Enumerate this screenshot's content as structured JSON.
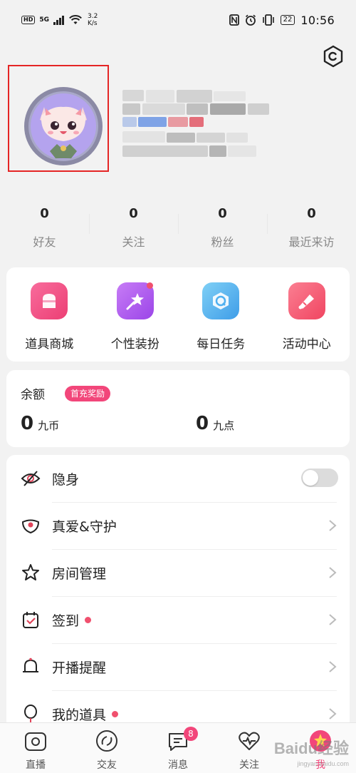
{
  "status_bar": {
    "hd": "HD",
    "signal": "5G",
    "speed_value": "3.2",
    "speed_unit": "K/s",
    "battery": "22",
    "time": "10:56"
  },
  "stats": [
    {
      "count": "0",
      "label": "好友"
    },
    {
      "count": "0",
      "label": "关注"
    },
    {
      "count": "0",
      "label": "粉丝"
    },
    {
      "count": "0",
      "label": "最近来访"
    }
  ],
  "quick_actions": [
    {
      "label": "道具商城",
      "color": "#f04d86",
      "icon": "shop-icon"
    },
    {
      "label": "个性装扮",
      "color": "#b45cf0",
      "icon": "magic-wand-icon",
      "dot": true
    },
    {
      "label": "每日任务",
      "color": "#4fb0f0",
      "icon": "task-badge-icon"
    },
    {
      "label": "活动中心",
      "color": "#f4566f",
      "icon": "megaphone-icon"
    }
  ],
  "balance": {
    "title": "余额",
    "badge": "首充奖励",
    "coins_value": "0",
    "coins_unit": "九币",
    "points_value": "0",
    "points_unit": "九点"
  },
  "menu": [
    {
      "label": "隐身",
      "icon": "eye-off-icon",
      "control": "toggle",
      "toggle_on": false
    },
    {
      "label": "真爱&守护",
      "icon": "mask-icon",
      "control": "chevron"
    },
    {
      "label": "房间管理",
      "icon": "star-icon",
      "control": "chevron"
    },
    {
      "label": "签到",
      "icon": "calendar-check-icon",
      "control": "chevron",
      "dot": true
    },
    {
      "label": "开播提醒",
      "icon": "bell-icon",
      "control": "chevron"
    },
    {
      "label": "我的道具",
      "icon": "balloon-icon",
      "control": "chevron",
      "dot": true
    }
  ],
  "bottom_nav": [
    {
      "label": "直播",
      "icon": "camera-icon"
    },
    {
      "label": "交友",
      "icon": "disc-icon"
    },
    {
      "label": "消息",
      "icon": "message-icon",
      "badge": "8"
    },
    {
      "label": "关注",
      "icon": "heart-pulse-icon"
    },
    {
      "label": "我",
      "icon": "me-star-icon",
      "active": true
    }
  ],
  "watermark": {
    "brand": "Baidu经验",
    "url": "jingyan.baidu.com"
  },
  "colors": {
    "accent": "#f2467a",
    "highlight_frame": "#e52525",
    "background": "#f2f2f2"
  }
}
